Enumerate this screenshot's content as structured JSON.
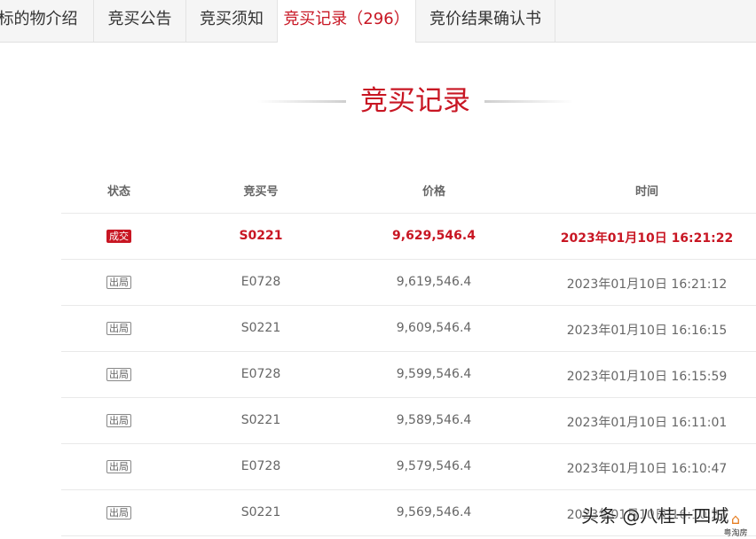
{
  "tabs": [
    {
      "label": "标的物介绍"
    },
    {
      "label": "竞买公告"
    },
    {
      "label": "竞买须知"
    },
    {
      "label": "竞买记录（296）"
    },
    {
      "label": "竞价结果确认书"
    }
  ],
  "section_title": "竞买记录",
  "table": {
    "headers": [
      "状态",
      "竞买号",
      "价格",
      "时间"
    ],
    "rows": [
      {
        "status": "成交",
        "bid_no": "S0221",
        "price": "9,629,546.4",
        "time": "2023年01月10日 16:21:22"
      },
      {
        "status": "出局",
        "bid_no": "E0728",
        "price": "9,619,546.4",
        "time": "2023年01月10日 16:21:12"
      },
      {
        "status": "出局",
        "bid_no": "S0221",
        "price": "9,609,546.4",
        "time": "2023年01月10日 16:16:15"
      },
      {
        "status": "出局",
        "bid_no": "E0728",
        "price": "9,599,546.4",
        "time": "2023年01月10日 16:15:59"
      },
      {
        "status": "出局",
        "bid_no": "S0221",
        "price": "9,589,546.4",
        "time": "2023年01月10日 16:11:01"
      },
      {
        "status": "出局",
        "bid_no": "E0728",
        "price": "9,579,546.4",
        "time": "2023年01月10日 16:10:47"
      },
      {
        "status": "出局",
        "bid_no": "S0221",
        "price": "9,569,546.4",
        "time": "2023年01月10日 16:10:23"
      }
    ]
  },
  "watermark": "头条 @八桂十四城",
  "logo_text": "粤淘房",
  "colors": {
    "accent": "#c81623"
  }
}
